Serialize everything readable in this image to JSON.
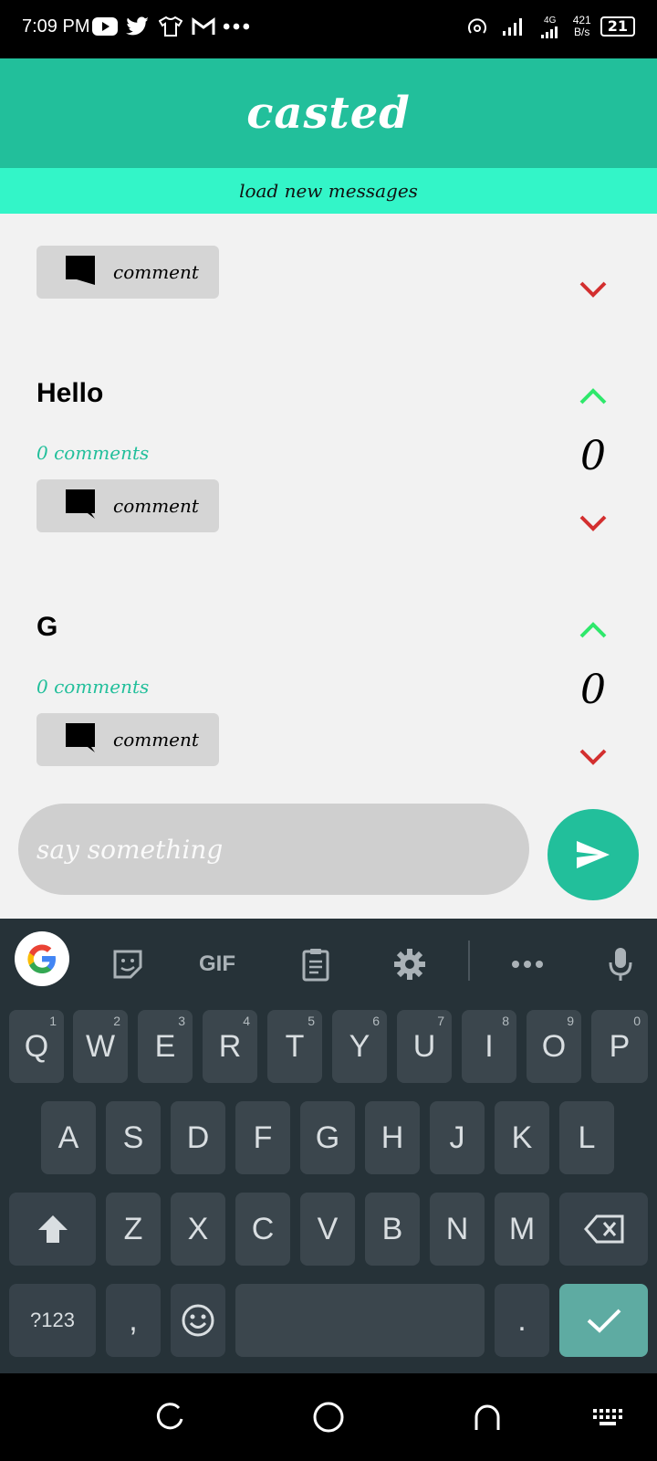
{
  "status_bar": {
    "time": "7:09 PM",
    "left_icons": [
      "youtube-icon",
      "twitter-icon",
      "tshirt-icon",
      "gmail-icon",
      "more-dots-icon"
    ],
    "network": "4G",
    "speed_value": "421",
    "speed_unit": "B/s",
    "battery": "21"
  },
  "app": {
    "title": "casted",
    "load_new": "load new messages",
    "accent": "#22bf9b",
    "load_bar_color": "#33f5c8"
  },
  "posts": [
    {
      "title": "",
      "comments": "",
      "comment_label": "comment",
      "votes": ""
    },
    {
      "title": "Hello",
      "comments": "0 comments",
      "comment_label": "comment",
      "votes": "0"
    },
    {
      "title": "G",
      "comments": "0 comments",
      "comment_label": "comment",
      "votes": "0"
    }
  ],
  "composer": {
    "placeholder": "say something"
  },
  "keyboard": {
    "toolbar": [
      "google-icon",
      "sticker-icon",
      "GIF",
      "clipboard-icon",
      "gear-icon",
      "more-dots-icon",
      "microphone-icon"
    ],
    "row1": [
      "Q",
      "W",
      "E",
      "R",
      "T",
      "Y",
      "U",
      "I",
      "O",
      "P"
    ],
    "row1_hints": [
      "1",
      "2",
      "3",
      "4",
      "5",
      "6",
      "7",
      "8",
      "9",
      "0"
    ],
    "row2": [
      "A",
      "S",
      "D",
      "F",
      "G",
      "H",
      "J",
      "K",
      "L"
    ],
    "row3": [
      "Z",
      "X",
      "C",
      "V",
      "B",
      "N",
      "M"
    ],
    "symbols": "?123",
    "comma": ",",
    "period": "."
  }
}
